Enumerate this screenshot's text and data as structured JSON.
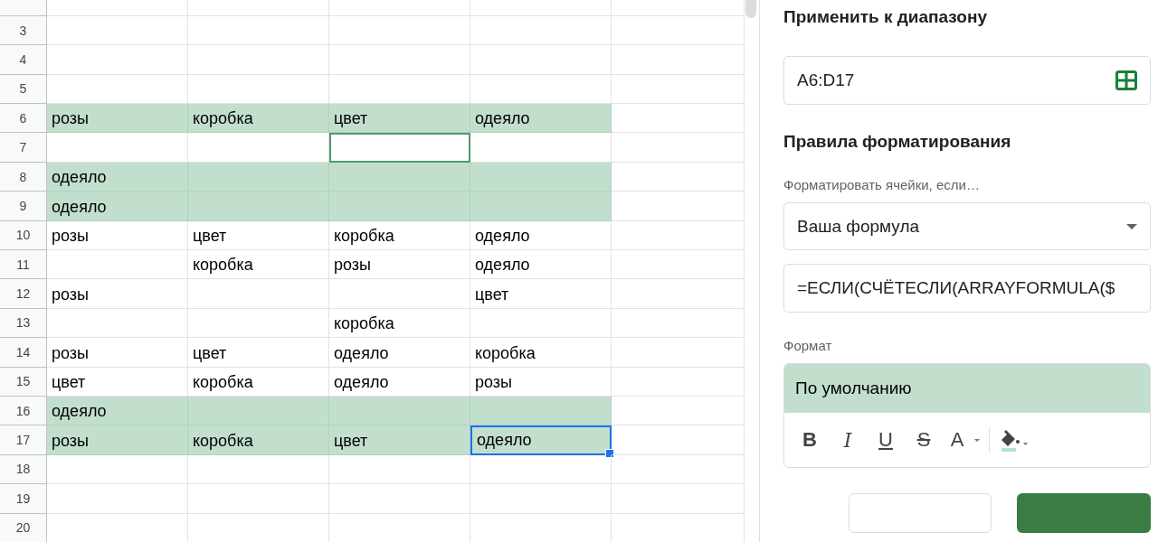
{
  "sheet": {
    "rows": [
      {
        "highlighted": false,
        "cells": [
          {
            "text": "",
            "selected": false,
            "outlined": false
          },
          {
            "text": "",
            "selected": false,
            "outlined": false
          },
          {
            "text": "",
            "selected": false,
            "outlined": false
          },
          {
            "text": "",
            "selected": false,
            "outlined": false
          }
        ]
      },
      {
        "number": "3",
        "highlighted": false,
        "cells": [
          {
            "text": "",
            "selected": false,
            "outlined": false
          },
          {
            "text": "",
            "selected": false,
            "outlined": false
          },
          {
            "text": "",
            "selected": false,
            "outlined": false
          },
          {
            "text": "",
            "selected": false,
            "outlined": false
          }
        ]
      },
      {
        "number": "4",
        "highlighted": false,
        "cells": [
          {
            "text": "",
            "selected": false,
            "outlined": false
          },
          {
            "text": "",
            "selected": false,
            "outlined": false
          },
          {
            "text": "",
            "selected": false,
            "outlined": false
          },
          {
            "text": "",
            "selected": false,
            "outlined": false
          }
        ]
      },
      {
        "number": "5",
        "highlighted": false,
        "cells": [
          {
            "text": "",
            "selected": false,
            "outlined": false
          },
          {
            "text": "",
            "selected": false,
            "outlined": false
          },
          {
            "text": "",
            "selected": false,
            "outlined": false
          },
          {
            "text": "",
            "selected": false,
            "outlined": false
          }
        ]
      },
      {
        "number": "6",
        "highlighted": true,
        "cells": [
          {
            "text": "розы",
            "selected": false,
            "outlined": false
          },
          {
            "text": "коробка",
            "selected": false,
            "outlined": false
          },
          {
            "text": "цвет",
            "selected": false,
            "outlined": false
          },
          {
            "text": "одеяло",
            "selected": false,
            "outlined": false
          }
        ]
      },
      {
        "number": "7",
        "highlighted": false,
        "cells": [
          {
            "text": "",
            "selected": false,
            "outlined": false
          },
          {
            "text": "",
            "selected": false,
            "outlined": false
          },
          {
            "text": "",
            "selected": false,
            "outlined": true
          },
          {
            "text": "",
            "selected": false,
            "outlined": false
          }
        ]
      },
      {
        "number": "8",
        "highlighted": true,
        "cells": [
          {
            "text": "одеяло",
            "selected": false,
            "outlined": false
          },
          {
            "text": "",
            "selected": false,
            "outlined": false
          },
          {
            "text": "",
            "selected": false,
            "outlined": false
          },
          {
            "text": "",
            "selected": false,
            "outlined": false
          }
        ]
      },
      {
        "number": "9",
        "highlighted": true,
        "cells": [
          {
            "text": "одеяло",
            "selected": false,
            "outlined": false
          },
          {
            "text": "",
            "selected": false,
            "outlined": false
          },
          {
            "text": "",
            "selected": false,
            "outlined": false
          },
          {
            "text": "",
            "selected": false,
            "outlined": false
          }
        ]
      },
      {
        "number": "10",
        "highlighted": false,
        "cells": [
          {
            "text": "розы",
            "selected": false,
            "outlined": false
          },
          {
            "text": "цвет",
            "selected": false,
            "outlined": false
          },
          {
            "text": "коробка",
            "selected": false,
            "outlined": false
          },
          {
            "text": "одеяло",
            "selected": false,
            "outlined": false
          }
        ]
      },
      {
        "number": "11",
        "highlighted": false,
        "cells": [
          {
            "text": "",
            "selected": false,
            "outlined": false
          },
          {
            "text": "коробка",
            "selected": false,
            "outlined": false
          },
          {
            "text": "розы",
            "selected": false,
            "outlined": false
          },
          {
            "text": "одеяло",
            "selected": false,
            "outlined": false
          }
        ]
      },
      {
        "number": "12",
        "highlighted": false,
        "cells": [
          {
            "text": "розы",
            "selected": false,
            "outlined": false
          },
          {
            "text": "",
            "selected": false,
            "outlined": false
          },
          {
            "text": "",
            "selected": false,
            "outlined": false
          },
          {
            "text": "цвет",
            "selected": false,
            "outlined": false
          }
        ]
      },
      {
        "number": "13",
        "highlighted": false,
        "cells": [
          {
            "text": "",
            "selected": false,
            "outlined": false
          },
          {
            "text": "",
            "selected": false,
            "outlined": false
          },
          {
            "text": "коробка",
            "selected": false,
            "outlined": false
          },
          {
            "text": "",
            "selected": false,
            "outlined": false
          }
        ]
      },
      {
        "number": "14",
        "highlighted": false,
        "cells": [
          {
            "text": "розы",
            "selected": false,
            "outlined": false
          },
          {
            "text": "цвет",
            "selected": false,
            "outlined": false
          },
          {
            "text": "одеяло",
            "selected": false,
            "outlined": false
          },
          {
            "text": "коробка",
            "selected": false,
            "outlined": false
          }
        ]
      },
      {
        "number": "15",
        "highlighted": false,
        "cells": [
          {
            "text": "цвет",
            "selected": false,
            "outlined": false
          },
          {
            "text": "коробка",
            "selected": false,
            "outlined": false
          },
          {
            "text": "одеяло",
            "selected": false,
            "outlined": false
          },
          {
            "text": "розы",
            "selected": false,
            "outlined": false
          }
        ]
      },
      {
        "number": "16",
        "highlighted": true,
        "cells": [
          {
            "text": "одеяло",
            "selected": false,
            "outlined": false
          },
          {
            "text": "",
            "selected": false,
            "outlined": false
          },
          {
            "text": "",
            "selected": false,
            "outlined": false
          },
          {
            "text": "",
            "selected": false,
            "outlined": false
          }
        ]
      },
      {
        "number": "17",
        "highlighted": true,
        "cells": [
          {
            "text": "розы",
            "selected": false,
            "outlined": false
          },
          {
            "text": "коробка",
            "selected": false,
            "outlined": false
          },
          {
            "text": "цвет",
            "selected": false,
            "outlined": false
          },
          {
            "text": "одеяло",
            "selected": true,
            "outlined": false
          }
        ]
      },
      {
        "number": "18",
        "highlighted": false,
        "cells": [
          {
            "text": "",
            "selected": false,
            "outlined": false
          },
          {
            "text": "",
            "selected": false,
            "outlined": false
          },
          {
            "text": "",
            "selected": false,
            "outlined": false
          },
          {
            "text": "",
            "selected": false,
            "outlined": false
          }
        ]
      },
      {
        "number": "19",
        "highlighted": false,
        "cells": [
          {
            "text": "",
            "selected": false,
            "outlined": false
          },
          {
            "text": "",
            "selected": false,
            "outlined": false
          },
          {
            "text": "",
            "selected": false,
            "outlined": false
          },
          {
            "text": "",
            "selected": false,
            "outlined": false
          }
        ]
      },
      {
        "number": "20",
        "highlighted": false,
        "cells": [
          {
            "text": "",
            "selected": false,
            "outlined": false
          },
          {
            "text": "",
            "selected": false,
            "outlined": false
          },
          {
            "text": "",
            "selected": false,
            "outlined": false
          },
          {
            "text": "",
            "selected": false,
            "outlined": false
          }
        ]
      }
    ]
  },
  "panel": {
    "range_heading": "Применить к диапазону",
    "range_value": "A6:D17",
    "rules_heading": "Правила форматирования",
    "condition_label": "Форматировать ячейки, если…",
    "condition_value": "Ваша формула",
    "formula_value": "=ЕСЛИ(СЧЁТЕСЛИ(ARRAYFORMULA($",
    "format_label": "Формат",
    "format_preview": "По умолчанию",
    "format_tools": [
      {
        "kind": "bold",
        "glyph": "B"
      },
      {
        "kind": "italic",
        "glyph": "I"
      },
      {
        "kind": "underline",
        "glyph": "U"
      },
      {
        "kind": "strike",
        "glyph": "S"
      },
      {
        "kind": "text-color",
        "glyph": "A"
      },
      {
        "kind": "fill"
      }
    ]
  }
}
